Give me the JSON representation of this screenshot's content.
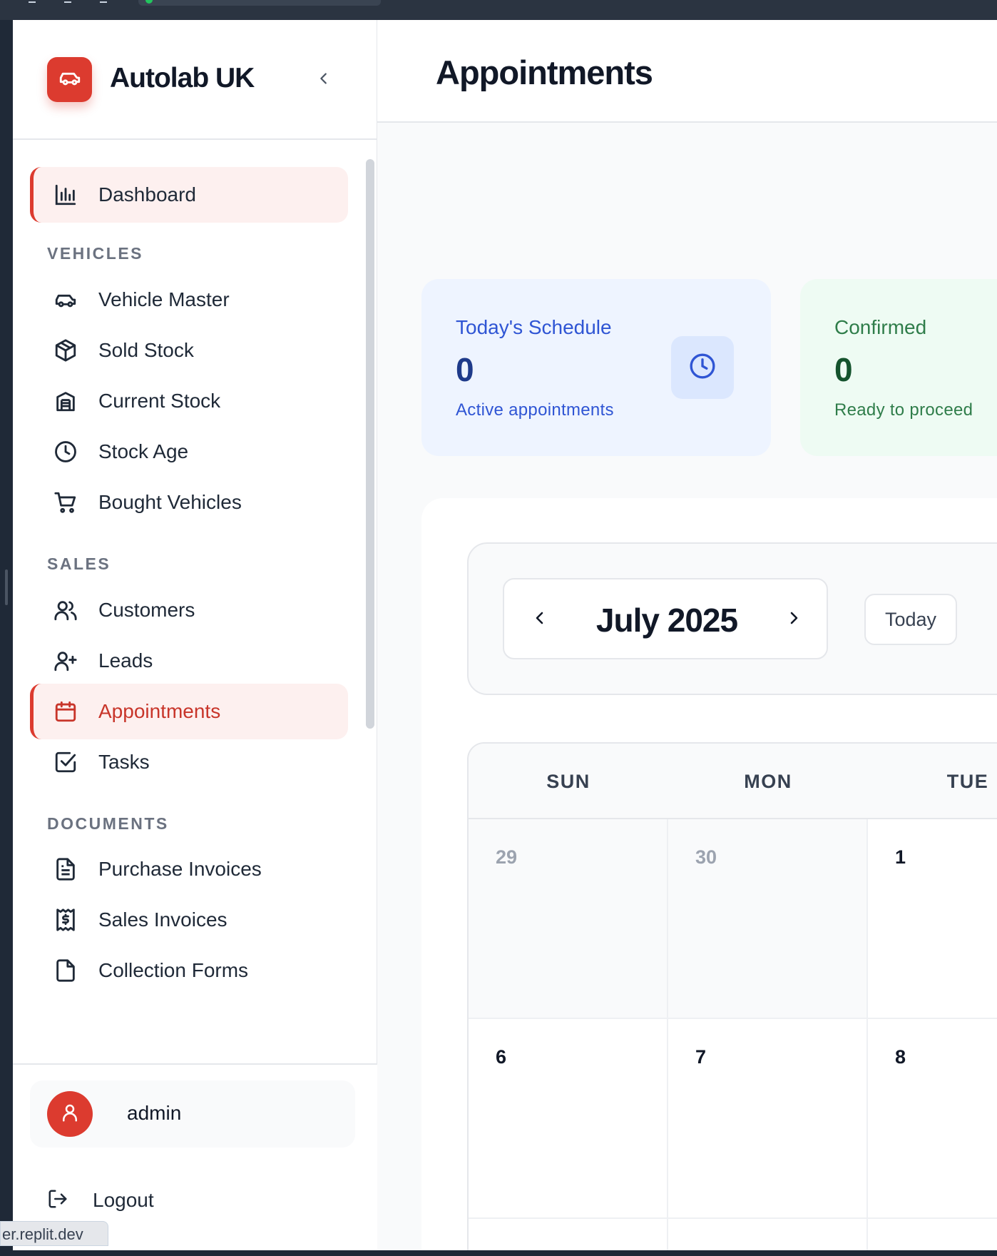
{
  "brand": {
    "name": "Autolab UK",
    "icon": "car-icon"
  },
  "sidebar": {
    "dashboard": {
      "label": "Dashboard",
      "icon": "bar-chart-icon"
    },
    "sections": {
      "vehicles": "VEHICLES",
      "sales": "SALES",
      "documents": "DOCUMENTS"
    },
    "vehicles": [
      {
        "label": "Vehicle Master",
        "icon": "car-icon"
      },
      {
        "label": "Sold Stock",
        "icon": "box-icon"
      },
      {
        "label": "Current Stock",
        "icon": "building-icon"
      },
      {
        "label": "Stock Age",
        "icon": "clock-icon"
      },
      {
        "label": "Bought Vehicles",
        "icon": "cart-icon"
      }
    ],
    "sales": [
      {
        "label": "Customers",
        "icon": "users-icon"
      },
      {
        "label": "Leads",
        "icon": "user-plus-icon"
      },
      {
        "label": "Appointments",
        "icon": "calendar-icon"
      },
      {
        "label": "Tasks",
        "icon": "check-square-icon"
      }
    ],
    "documents": [
      {
        "label": "Purchase Invoices",
        "icon": "file-text-icon"
      },
      {
        "label": "Sales Invoices",
        "icon": "receipt-icon"
      },
      {
        "label": "Collection Forms",
        "icon": "file-icon"
      }
    ],
    "user": {
      "name": "admin"
    },
    "logout": "Logout"
  },
  "status_tip": "er.replit.dev",
  "main": {
    "title": "Appointments",
    "stats": [
      {
        "label": "Today's Schedule",
        "value": "0",
        "sub": "Active appointments",
        "icon": "clock-icon"
      },
      {
        "label": "Confirmed",
        "value": "0",
        "sub": "Ready to proceed"
      }
    ],
    "calendar": {
      "month": "July 2025",
      "today_label": "Today",
      "weekdays": [
        "SUN",
        "MON",
        "TUE"
      ],
      "rows": [
        [
          "29",
          "30",
          "1"
        ],
        [
          "6",
          "7",
          "8"
        ]
      ]
    }
  },
  "colors": {
    "accent": "#dc3b2f",
    "blue": "#2f55d4",
    "green": "#2f7d4a"
  }
}
